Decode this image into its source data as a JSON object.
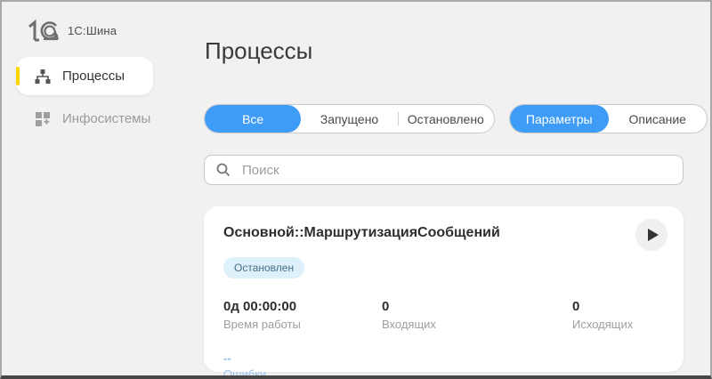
{
  "app": {
    "brand": "1С:Шина"
  },
  "sidebar": {
    "items": [
      {
        "label": "Процессы",
        "icon": "sitemap-icon",
        "active": true
      },
      {
        "label": "Инфосистемы",
        "icon": "grid-plus-icon",
        "active": false
      }
    ]
  },
  "header": {
    "title": "Процессы"
  },
  "filters": {
    "status_tabs": [
      {
        "label": "Все",
        "active": true
      },
      {
        "label": "Запущено",
        "active": false
      },
      {
        "label": "Остановлено",
        "active": false
      }
    ],
    "view_tabs": [
      {
        "label": "Параметры",
        "active": true
      },
      {
        "label": "Описание",
        "active": false
      }
    ]
  },
  "search": {
    "placeholder": "Поиск"
  },
  "process_card": {
    "title": "Основной::МаршрутизацияСообщений",
    "status_badge": "Остановлен",
    "stats": [
      {
        "value": "0д 00:00:00",
        "label": "Время работы"
      },
      {
        "value": "0",
        "label": "Входящих"
      },
      {
        "value": "0",
        "label": "Исходящих"
      }
    ],
    "errors": {
      "value": "--",
      "label": "Ошибки"
    }
  },
  "colors": {
    "accent_blue": "#3e9cf6",
    "accent_yellow": "#ffd500",
    "badge_bg": "#def0fa",
    "badge_text": "#44708a",
    "link_blue": "#9cc5ee"
  }
}
